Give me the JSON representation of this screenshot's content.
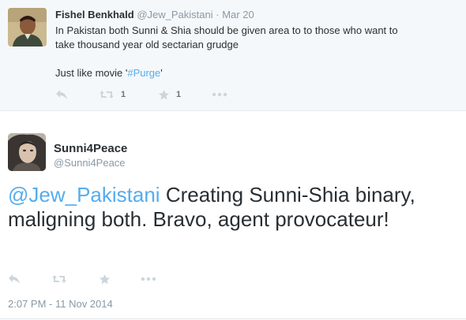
{
  "parent_tweet": {
    "author_name": "Fishel Benkhald",
    "handle": "@Jew_Pakistani",
    "separator": "·",
    "date": "Mar 20",
    "text_line1": "In Pakistan both Sunni & Shia should be given area to to those who want to",
    "text_line2": "take thousand year old sectarian grudge",
    "text_line3_prefix": "Just like movie '",
    "text_line3_hashtag": "#Purge",
    "text_line3_suffix": "'",
    "retweet_count": "1",
    "favorite_count": "1",
    "icons": [
      "reply-icon",
      "retweet-icon",
      "favorite-icon",
      "more-icon"
    ]
  },
  "main_tweet": {
    "author_name": "Sunni4Peace",
    "handle": "@Sunni4Peace",
    "mention": "@Jew_Pakistani",
    "text": " Creating Sunni-Shia binary, maligning both. Bravo, agent provocateur!",
    "timestamp": "2:07 PM - 11 Nov 2014",
    "icons": [
      "reply-icon",
      "retweet-icon",
      "favorite-icon",
      "more-icon"
    ]
  },
  "colors": {
    "link": "#55acee",
    "icon": "#ccd6dd",
    "muted": "#8899a6",
    "text": "#292f33",
    "parent_background": "#f5f8fa"
  }
}
